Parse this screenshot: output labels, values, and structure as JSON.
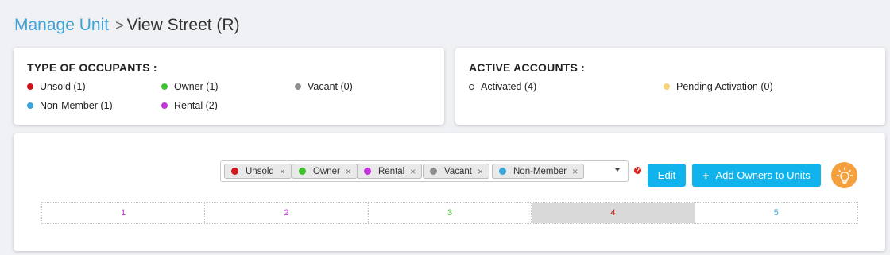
{
  "breadcrumb": {
    "parent": "Manage Unit",
    "separator": ">",
    "current": "View Street (R)"
  },
  "occupants": {
    "title": "TYPE OF OCCUPANTS :",
    "items": [
      {
        "label": "Unsold (1)",
        "color": "#d0161b"
      },
      {
        "label": "Owner (1)",
        "color": "#3dc42c"
      },
      {
        "label": "Vacant (0)",
        "color": "#8e8e8e"
      },
      {
        "label": "Non-Member (1)",
        "color": "#3ba6dc"
      },
      {
        "label": "Rental (2)",
        "color": "#c632de"
      }
    ]
  },
  "accounts": {
    "title": "ACTIVE ACCOUNTS :",
    "items": [
      {
        "label": "Activated (4)",
        "color": "#ffffff"
      },
      {
        "label": "Pending Activation (0)",
        "color": "#f7d37a"
      }
    ]
  },
  "filter": {
    "tags": [
      {
        "label": "Unsold",
        "color": "#d0161b"
      },
      {
        "label": "Owner",
        "color": "#3dc42c"
      },
      {
        "label": "Rental",
        "color": "#c632de"
      },
      {
        "label": "Vacant",
        "color": "#8e8e8e"
      },
      {
        "label": "Non-Member",
        "color": "#3ba6dc"
      }
    ],
    "remove_glyph": "×",
    "help_glyph": "?"
  },
  "actions": {
    "edit_label": "Edit",
    "add_owners_label": "Add Owners to Units",
    "plus_glyph": "+"
  },
  "units": [
    {
      "label": "1",
      "color": "#c632de",
      "highlight": false
    },
    {
      "label": "2",
      "color": "#c632de",
      "highlight": false
    },
    {
      "label": "3",
      "color": "#3dc42c",
      "highlight": false
    },
    {
      "label": "4",
      "color": "#d0161b",
      "highlight": true
    },
    {
      "label": "5",
      "color": "#3ba6dc",
      "highlight": false
    }
  ],
  "colors": {
    "accent": "#11b3ec",
    "link": "#3ea2d8",
    "bulb": "#f5a03f",
    "highlight_cell": "#d9d9d9"
  }
}
